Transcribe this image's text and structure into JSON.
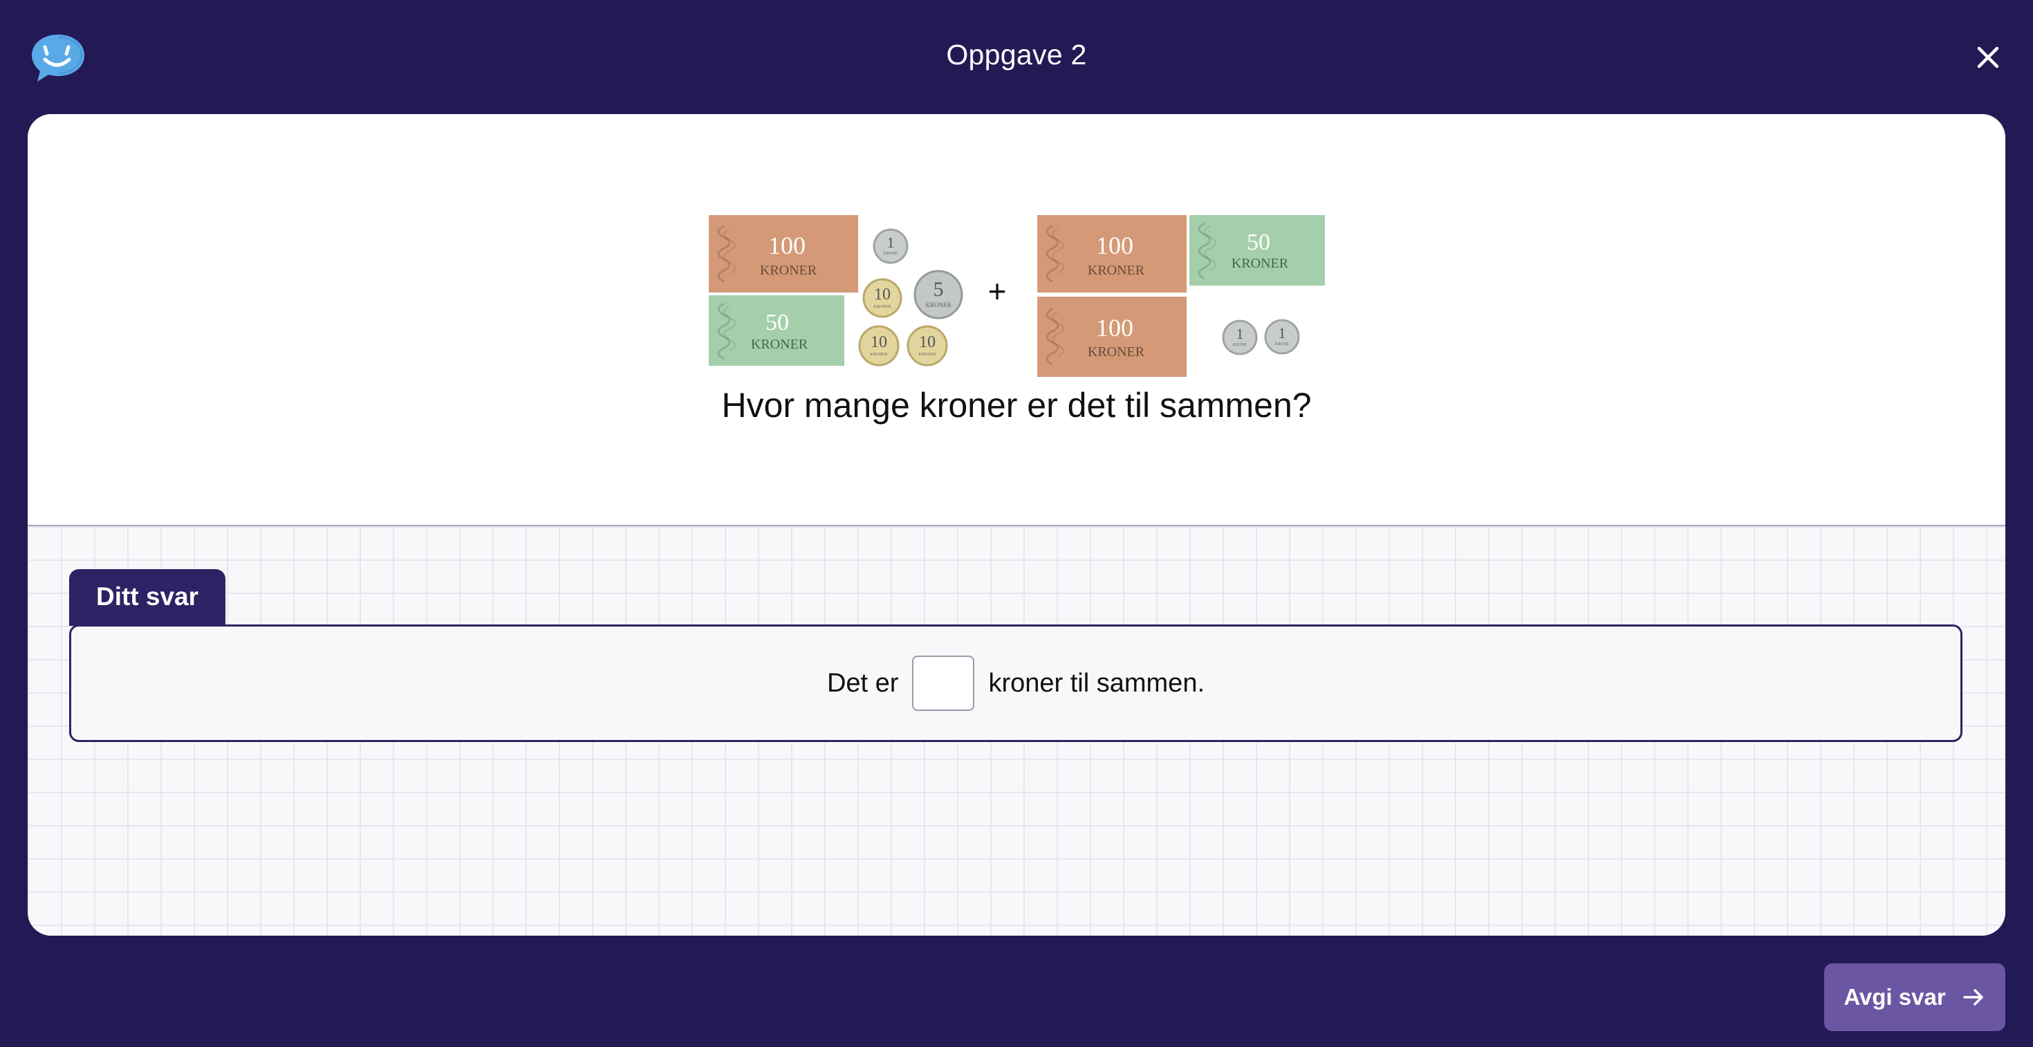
{
  "header": {
    "title": "Oppgave 2",
    "logo_icon": "smiling-chat-bubble-icon",
    "close_icon": "close-icon"
  },
  "question": {
    "text": "Hvor mange kroner er det til sammen?",
    "plus_sign": "+",
    "group1": {
      "notes": [
        {
          "value": "100",
          "unit": "KRONER"
        },
        {
          "value": "50",
          "unit": "KRONER"
        }
      ],
      "coins": [
        {
          "value": "1",
          "unit": "KRONE"
        },
        {
          "value": "10",
          "unit": "KRONER"
        },
        {
          "value": "5",
          "unit": "KRONER"
        },
        {
          "value": "10",
          "unit": "KRONER"
        },
        {
          "value": "10",
          "unit": "KRONER"
        }
      ]
    },
    "group2": {
      "notes": [
        {
          "value": "100",
          "unit": "KRONER"
        },
        {
          "value": "50",
          "unit": "KRONER"
        },
        {
          "value": "100",
          "unit": "KRONER"
        }
      ],
      "coins": [
        {
          "value": "1",
          "unit": "KRONE"
        },
        {
          "value": "1",
          "unit": "KRONE"
        }
      ]
    }
  },
  "answer": {
    "tab_label": "Ditt svar",
    "prefix": "Det er",
    "input_value": "",
    "suffix": "kroner til sammen."
  },
  "footer": {
    "submit_label": "Avgi svar",
    "submit_icon": "arrow-right-icon"
  },
  "colors": {
    "background": "#231a55",
    "card": "#ffffff",
    "tab": "#2e2264",
    "submit_button": "#6b56a3",
    "note_100": "#d49a77",
    "note_50": "#a5cfaa",
    "coin_1": "#c8cccb",
    "coin_5": "#c3c7c6",
    "coin_10": "#e2d59e"
  }
}
